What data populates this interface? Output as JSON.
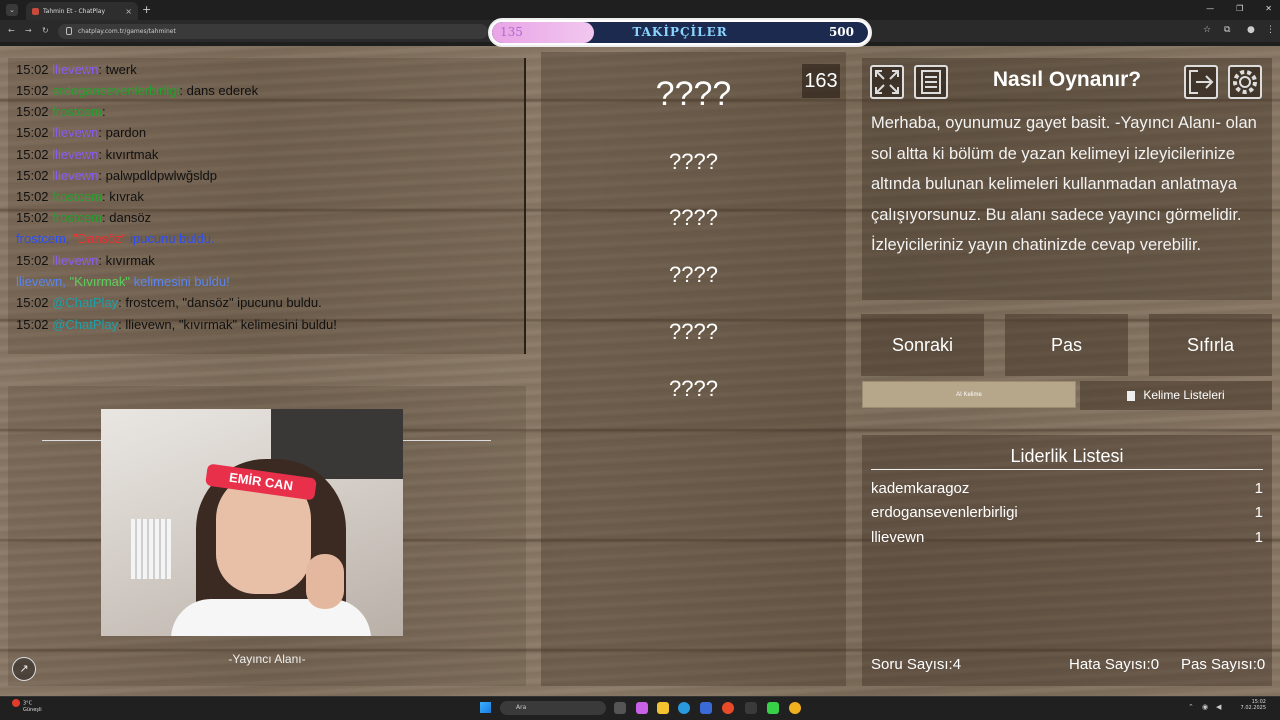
{
  "browser": {
    "tab_title": "Tahmin Et - ChatPlay",
    "tab_close": "×",
    "new_tab": "+",
    "menu": "⌄",
    "url": "chatplay.com.tr/games/tahminet",
    "window_controls": [
      "—",
      "❐",
      "✕"
    ]
  },
  "follower_bar": {
    "current": "135",
    "title": "TAKİPÇİLER",
    "goal": "500",
    "fill_fraction": 0.27
  },
  "chat": {
    "messages": [
      {
        "time": "15:02",
        "user": "llievewn",
        "text": ": twerk",
        "color": "purple"
      },
      {
        "time": "15:02",
        "user": "erdogansevenlerbirligi",
        "text": ": dans ederek",
        "color": "green"
      },
      {
        "time": "15:02",
        "user": "frostcem",
        "text": ": ",
        "color": "green"
      },
      {
        "time": "15:02",
        "user": "llievewn",
        "text": ": pardon",
        "color": "purple"
      },
      {
        "time": "15:02",
        "user": "llievewn",
        "text": ": kıvırtmak",
        "color": "purple"
      },
      {
        "time": "15:02",
        "user": "llievewn",
        "text": ": palwpdldpwlwğsldp",
        "color": "purple"
      },
      {
        "time": "15:02",
        "user": "frostcem",
        "text": ": kıvrak",
        "color": "green"
      },
      {
        "time": "15:02",
        "user": "frostcem",
        "text": ": dansöz",
        "color": "green"
      }
    ],
    "system_1": {
      "user": "frostcem,",
      "word": "\"Dansöz\"",
      "text": "ipucunu buldu."
    },
    "message_9": {
      "time": "15:02",
      "user": "llievewn",
      "text": ": kıvırmak"
    },
    "system_2": {
      "user": "llievewn,",
      "word": "\"Kıvırmak\"",
      "text": "kelimesini buldu!"
    },
    "bot_1": {
      "time": "15:02",
      "user": "@ChatPlay",
      "text": ": frostcem, \"dansöz\" ipucunu buldu."
    },
    "bot_2": {
      "time": "15:02",
      "user": "@ChatPlay",
      "text": ": llievewn, \"kıvırmak\" kelimesini buldu!"
    }
  },
  "streamer": {
    "label": "-Yayıncı Alanı-",
    "headband_text": "EMİR CAN",
    "corner_icon": "compass-icon"
  },
  "game": {
    "counter": "163",
    "hidden_words": [
      "????",
      "????",
      "????",
      "????",
      "????",
      "????"
    ]
  },
  "help": {
    "title": "Nasıl Oynanır?",
    "text": "Merhaba, oyunumuz gayet basit. -Yayıncı Alanı- olan sol altta ki bölüm de yazan kelimeyi izleyicilerinize altında bulunan kelimeleri kullanmadan anlatmaya çalışıyorsunuz. Bu alanı sadece yayıncı görmelidir. İzleyicileriniz yayın chatinizde cevap verebilir."
  },
  "controls": {
    "next": "Sonraki",
    "pass": "Pas",
    "reset": "Sıfırla",
    "tab_ai": "AI Kelime",
    "tab_lists": "Kelime Listeleri"
  },
  "leaderboard": {
    "title": "Liderlik Listesi",
    "rows": [
      {
        "name": "kademkaragoz",
        "score": "1"
      },
      {
        "name": "erdogansevenlerbirligi",
        "score": "1"
      },
      {
        "name": "llievewn",
        "score": "1"
      }
    ],
    "questions": "Soru Sayısı:4",
    "errors": "Hata Sayısı:0",
    "passes": "Pas Sayısı:0"
  },
  "taskbar": {
    "weather_temp": "3°C",
    "weather_desc": "Güneşli",
    "search": "Ara",
    "time": "15:02",
    "date": "7.02.2025"
  },
  "colors": {
    "wood": "#7d6c5a",
    "follow_fill": "#e9a4e6",
    "follow_title": "#8ad4ff",
    "chat_purple": "#8a5cf0",
    "chat_green": "#26a02e",
    "chat_blue": "#2a4ef0",
    "chat_red": "#f03030",
    "chat_teal": "#1ea0a8"
  }
}
